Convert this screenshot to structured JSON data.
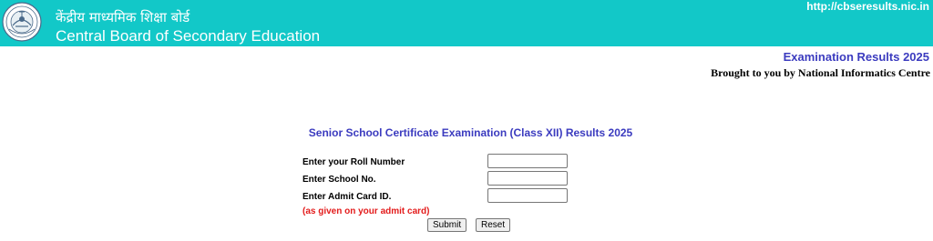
{
  "header": {
    "hindi_title": "केंद्रीय माध्यमिक शिक्षा बोर्ड",
    "english_title": "Central Board of Secondary Education",
    "url": "http://cbseresults.nic.in",
    "logo_icon": "cbse-emblem-icon",
    "background_color": "#12c8c8"
  },
  "banner": {
    "exam_results": "Examination Results 2025",
    "credit": "Brought to you by National Informatics Centre",
    "accent_color": "#3b3bbf"
  },
  "form": {
    "heading": "Senior School Certificate Examination (Class XII) Results 2025",
    "fields": [
      {
        "label": "Enter your Roll Number",
        "value": "",
        "placeholder": ""
      },
      {
        "label": "Enter School No.",
        "value": "",
        "placeholder": ""
      },
      {
        "label": "Enter Admit Card ID.",
        "value": "",
        "placeholder": ""
      }
    ],
    "note": "(as given on your admit card)",
    "note_color": "#e31b1b",
    "submit_label": "Submit",
    "reset_label": "Reset"
  }
}
